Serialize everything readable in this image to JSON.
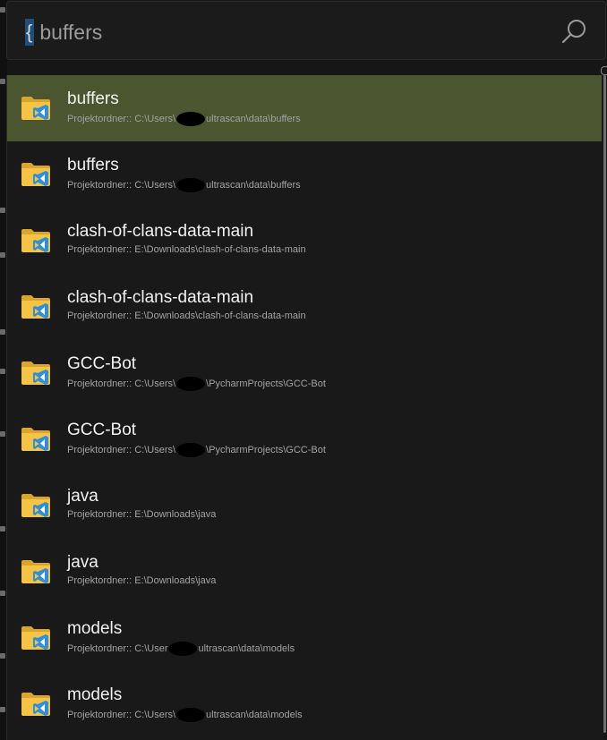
{
  "search": {
    "prefix": "{",
    "query": "buffers"
  },
  "results": [
    {
      "title": "buffers",
      "path_before": "Projektordner:: C:\\Users\\",
      "path_after": "ultrascan\\data\\buffers",
      "redacted": true,
      "selected": true
    },
    {
      "title": "buffers",
      "path_before": "Projektordner:: C:\\Users\\",
      "path_after": "ultrascan\\data\\buffers",
      "redacted": true,
      "selected": false
    },
    {
      "title": "clash-of-clans-data-main",
      "path_before": "Projektordner:: E:\\Downloads\\clash-of-clans-data-main",
      "path_after": "",
      "redacted": false,
      "selected": false
    },
    {
      "title": "clash-of-clans-data-main",
      "path_before": "Projektordner:: E:\\Downloads\\clash-of-clans-data-main",
      "path_after": "",
      "redacted": false,
      "selected": false
    },
    {
      "title": "GCC-Bot",
      "path_before": "Projektordner:: C:\\Users\\",
      "path_after": "\\PycharmProjects\\GCC-Bot",
      "redacted": true,
      "selected": false
    },
    {
      "title": "GCC-Bot",
      "path_before": "Projektordner:: C:\\Users\\",
      "path_after": "\\PycharmProjects\\GCC-Bot",
      "redacted": true,
      "selected": false
    },
    {
      "title": "java",
      "path_before": "Projektordner:: E:\\Downloads\\java",
      "path_after": "",
      "redacted": false,
      "selected": false
    },
    {
      "title": "java",
      "path_before": "Projektordner:: E:\\Downloads\\java",
      "path_after": "",
      "redacted": false,
      "selected": false
    },
    {
      "title": "models",
      "path_before": "Projektordner:: C:\\User",
      "path_after": "ultrascan\\data\\models",
      "redacted": true,
      "selected": false
    },
    {
      "title": "models",
      "path_before": "Projektordner:: C:\\Users\\",
      "path_after": "ultrascan\\data\\models",
      "redacted": true,
      "selected": false
    }
  ],
  "icons": {
    "search": "search-icon",
    "folder": "vscode-folder-icon"
  },
  "colors": {
    "selected_row": "#4b5530",
    "prefix_highlight": "#1f4e79",
    "folder_yellow": "#f5c445",
    "vscode_blue": "#2f8fd8"
  }
}
